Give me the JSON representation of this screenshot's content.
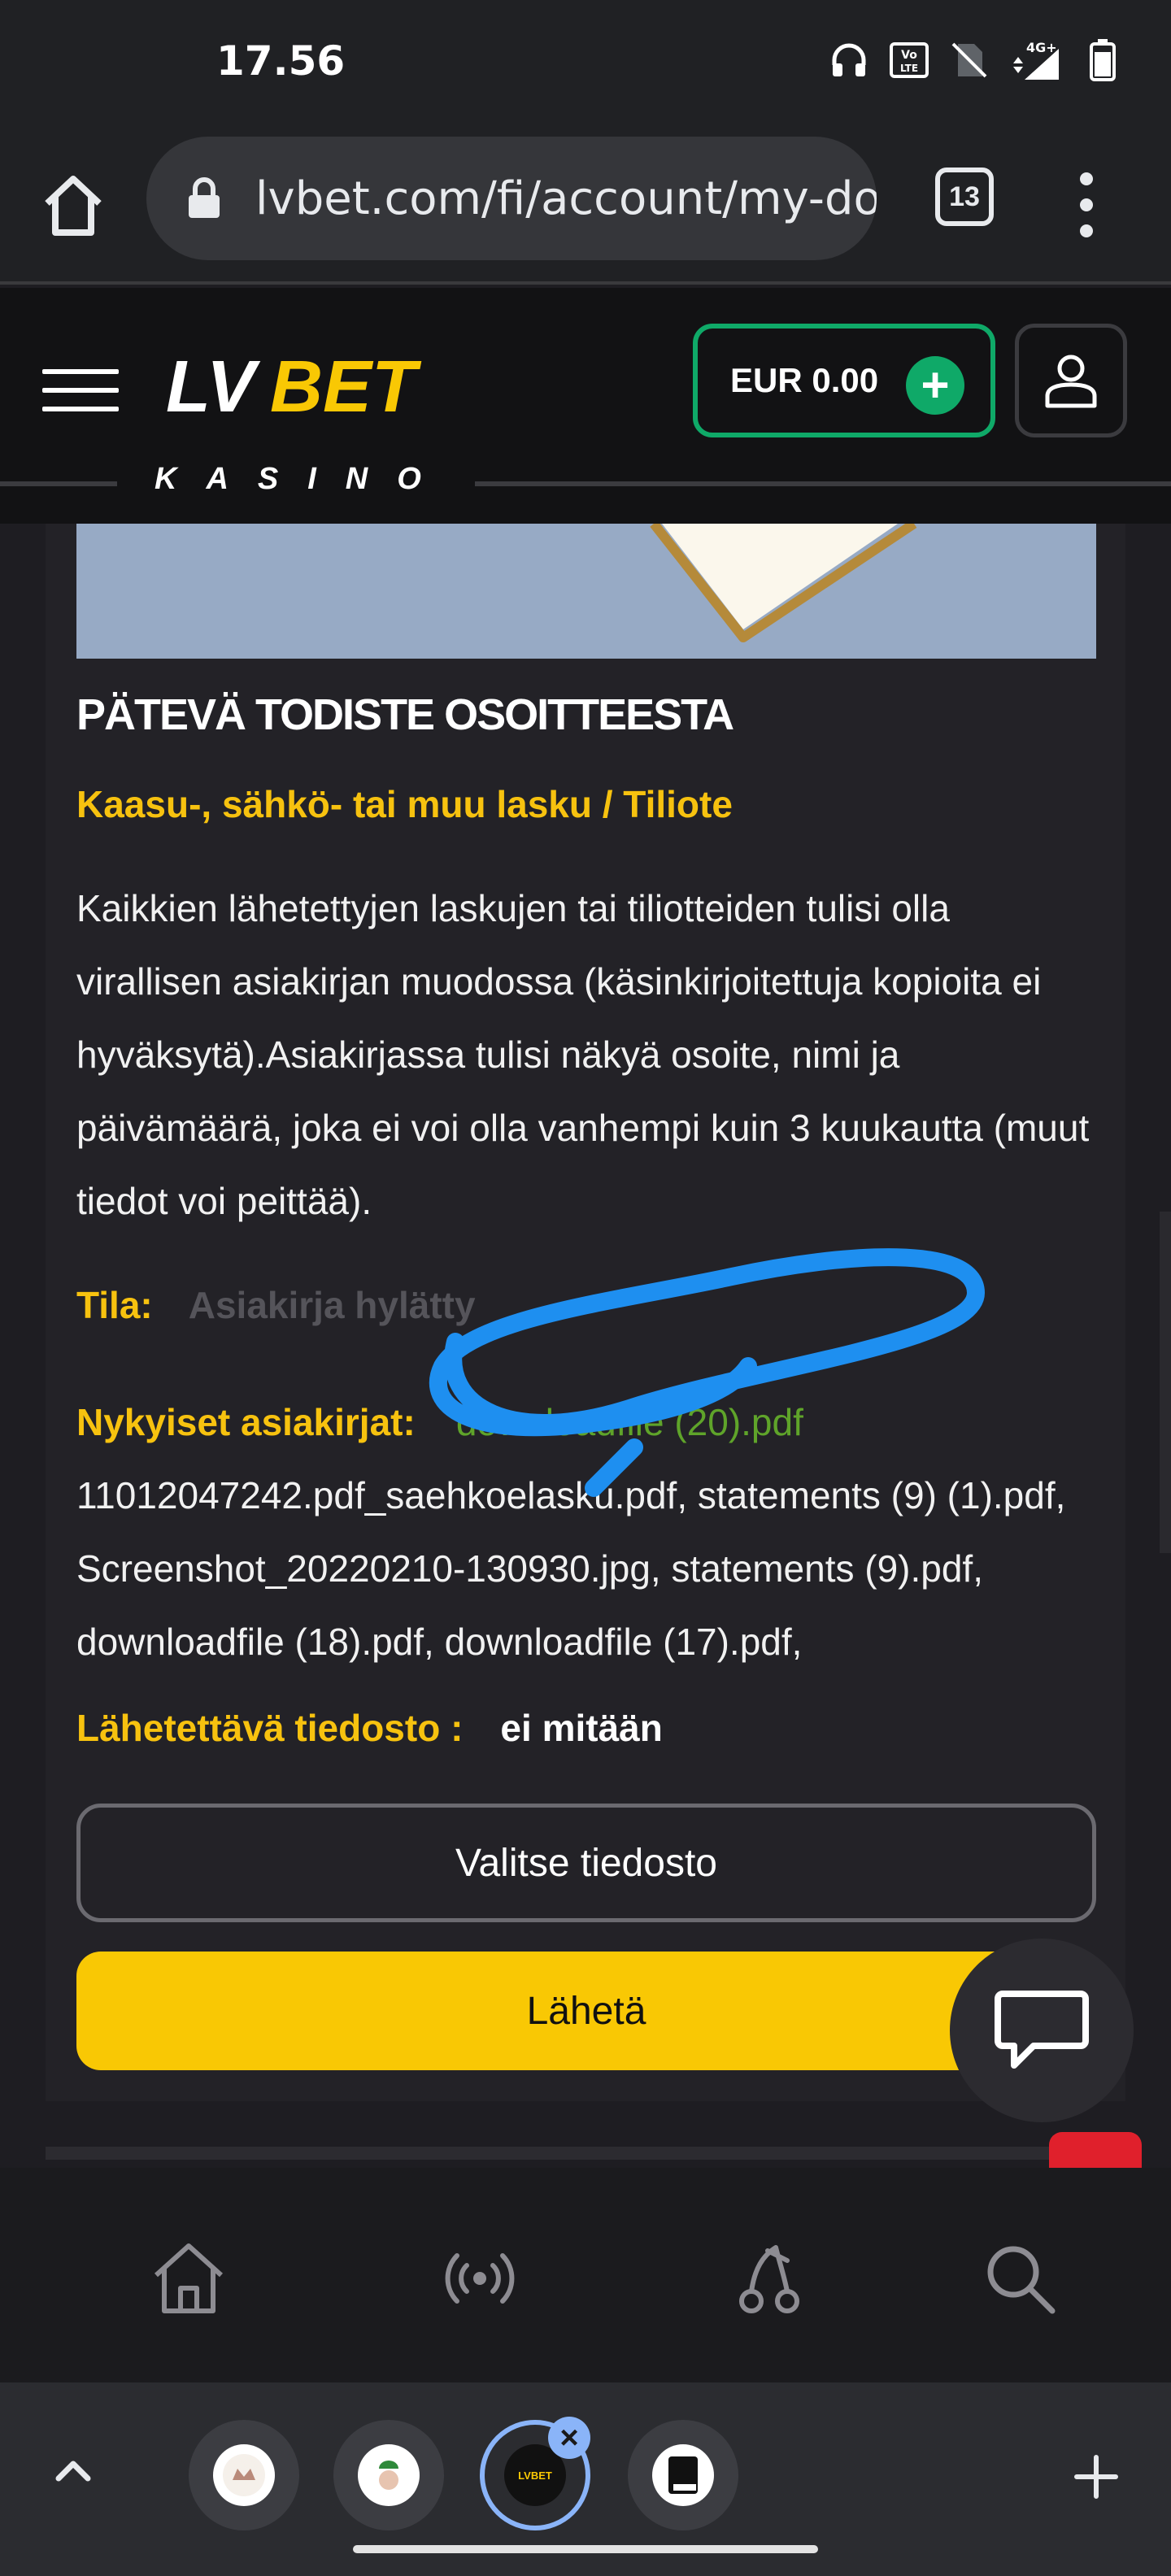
{
  "status_bar": {
    "time": "17.56",
    "network": "4G+",
    "icons": [
      "headphones-icon",
      "volte-icon",
      "no-sim-icon",
      "signal-icon",
      "battery-icon"
    ]
  },
  "browser": {
    "url": "lvbet.com/fi/account/my-do",
    "tab_count": "13"
  },
  "site_header": {
    "logo_lv": "LV",
    "logo_bet": "BET",
    "logo_sub": "KASINO",
    "balance": "EUR 0.00",
    "accent_color": "#0fa968",
    "brand_yellow": "#f9c804"
  },
  "document": {
    "title": "PÄTEVÄ TODISTE OSOITTEESTA",
    "subtitle": "Kaasu-, sähkö- tai muu lasku / Tiliote",
    "description": "Kaikkien lähetettyjen laskujen tai tiliotteiden tulisi olla virallisen asiakirjan muodossa (käsinkirjoitettuja kopioita ei hyväksytä).Asiakirjassa tulisi näkyä osoite, nimi ja päivämäärä, joka ei voi olla vanhempi kuin 3 kuukautta (muut tiedot voi peittää).",
    "status_label": "Tila:",
    "status_value": "Asiakirja hylätty",
    "current_label": "Nykyiset asiakirjat:",
    "current_first": "downloadfile (20).pdf",
    "current_rest": "11012047242.pdf_saehkoelasku.pdf, statements (9) (1).pdf,  Screenshot_20220210-130930.jpg,  statements (9).pdf,  downloadfile (18).pdf,  downloadfile (17).pdf,",
    "upload_label": "Lähetettävä tiedosto :",
    "upload_value": "ei mitään",
    "choose_button": "Valitse tiedosto",
    "send_button": "Lähetä"
  },
  "bottom_nav": {
    "items": [
      "home-icon",
      "live-icon",
      "cherries-icon",
      "search-icon"
    ]
  },
  "tab_strip": {
    "tabs": [
      "tab-1",
      "tab-2",
      "tab-lvbet",
      "tab-4"
    ],
    "active_tab_label": "LVBET"
  }
}
